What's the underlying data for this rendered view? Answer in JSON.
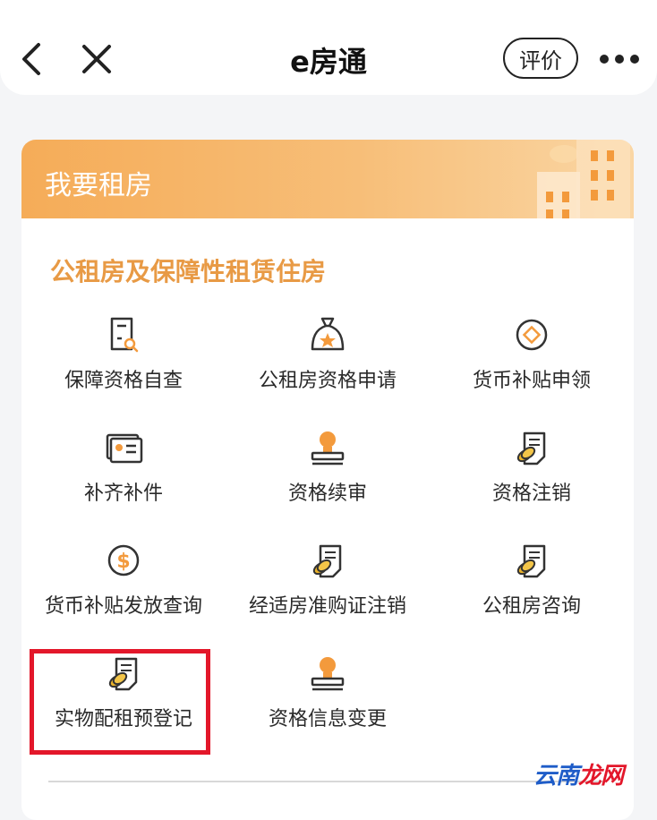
{
  "nav": {
    "title": "e房通",
    "rate_label": "评价"
  },
  "card": {
    "title": "我要租房",
    "section_title": "公租房及保障性租赁住房",
    "items": [
      {
        "label": "保障资格自查",
        "icon": "document-search-icon"
      },
      {
        "label": "公租房资格申请",
        "icon": "star-bag-icon"
      },
      {
        "label": "货币补贴申领",
        "icon": "diamond-coin-icon"
      },
      {
        "label": "补齐补件",
        "icon": "id-card-icon"
      },
      {
        "label": "资格续审",
        "icon": "stamp-icon"
      },
      {
        "label": "资格注销",
        "icon": "document-coin-icon"
      },
      {
        "label": "货币补贴发放查询",
        "icon": "dollar-coin-icon"
      },
      {
        "label": "经适房准购证注销",
        "icon": "document-coin-icon"
      },
      {
        "label": "公租房咨询",
        "icon": "document-coin-icon"
      },
      {
        "label": "实物配租预登记",
        "icon": "document-coin-icon"
      },
      {
        "label": "资格信息变更",
        "icon": "stamp-icon"
      }
    ]
  },
  "watermark": {
    "text_a": "云南",
    "text_b": "龙网"
  },
  "colors": {
    "accent_orange": "#e89a45",
    "header_gradient_start": "#f5ac58",
    "highlight_red": "#e3172a"
  }
}
